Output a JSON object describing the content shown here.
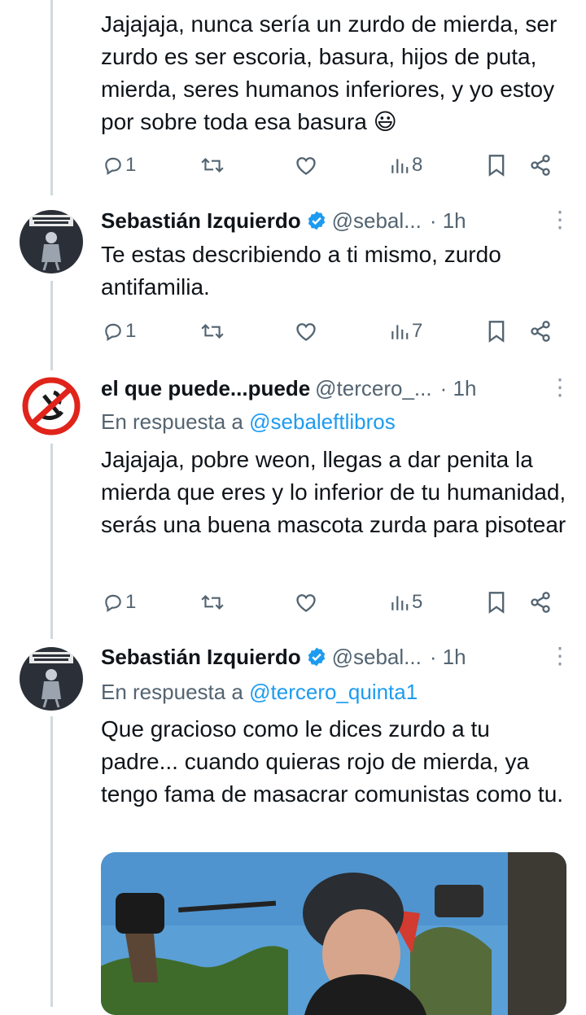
{
  "tweets": [
    {
      "text": "Jajajaja, nunca sería un zurdo de mierda, ser zurdo es ser escoria, basura, hijos de puta, mierda, seres humanos inferiores, y yo estoy por sobre toda esa basura 😃",
      "replies": "1",
      "views": "8"
    },
    {
      "name": "Sebastián Izquierdo",
      "handle": "@sebal...",
      "time": "· 1h",
      "text": "Te estas describiendo a ti mismo, zurdo antifamilia.",
      "replies": "1",
      "views": "7"
    },
    {
      "name": "el que puede...puede",
      "handle": "@tercero_...",
      "time": "· 1h",
      "reply_prefix": "En respuesta a",
      "reply_to": "@sebaleftlibros",
      "text": "Jajajaja, pobre weon, llegas a dar penita la mierda que eres y lo inferior de tu humanidad, serás una buena mascota zurda para pisotear",
      "replies": "1",
      "views": "5"
    },
    {
      "name": "Sebastián Izquierdo",
      "handle": "@sebal...",
      "time": "· 1h",
      "reply_prefix": "En respuesta a",
      "reply_to": "@tercero_quinta1",
      "text": "Que gracioso como le dices zurdo a tu padre... cuando quieras rojo de mierda, ya tengo fama de masacrar comunistas como tu."
    }
  ],
  "colors": {
    "link": "#1d9bf0",
    "secondary": "#536471",
    "verified": "#1d9bf0",
    "thread_line": "#cfd9de"
  },
  "icons": [
    "reply-icon",
    "retweet-icon",
    "like-icon",
    "views-icon",
    "bookmark-icon",
    "share-icon",
    "verified-icon",
    "more-icon"
  ]
}
